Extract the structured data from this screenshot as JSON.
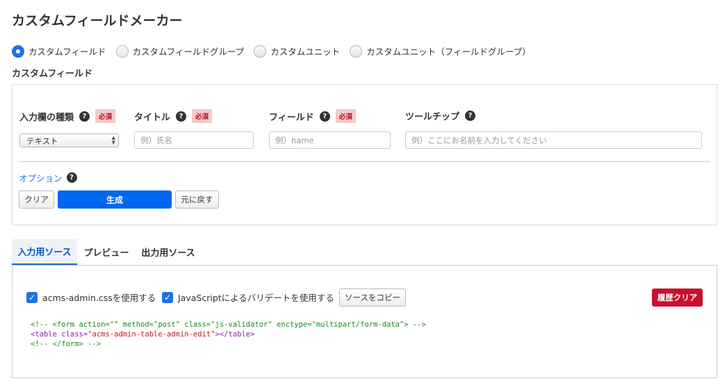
{
  "page_title": "カスタムフィールドメーカー",
  "radios": [
    {
      "label": "カスタムフィールド",
      "selected": true
    },
    {
      "label": "カスタムフィールドグループ",
      "selected": false
    },
    {
      "label": "カスタムユニット",
      "selected": false
    },
    {
      "label": "カスタムユニット（フィールドグループ）",
      "selected": false
    }
  ],
  "section_label": "カスタムフィールド",
  "columns": {
    "input_type": {
      "label": "入力欄の種類",
      "required": "必須",
      "value": "テキスト"
    },
    "title": {
      "label": "タイトル",
      "required": "必須",
      "placeholder": "例）氏名"
    },
    "field": {
      "label": "フィールド",
      "required": "必須",
      "placeholder": "例）name"
    },
    "tooltip": {
      "label": "ツールチップ",
      "placeholder": "例）ここにお名前を入力してください"
    }
  },
  "help_glyph": "?",
  "options_label": "オプション",
  "buttons": {
    "clear": "クリア",
    "generate": "生成",
    "undo": "元に戻す",
    "copy_source": "ソースをコピー",
    "clear_history": "履歴クリア"
  },
  "tabs": [
    {
      "label": "入力用ソース",
      "active": true
    },
    {
      "label": "プレビュー",
      "active": false
    },
    {
      "label": "出力用ソース",
      "active": false
    }
  ],
  "checkboxes": [
    {
      "label": "acms-admin.cssを使用する",
      "checked": true
    },
    {
      "label": "JavaScriptによるバリデートを使用する",
      "checked": true
    }
  ],
  "code": {
    "line1": "<!-- <form action=\"\" method=\"post\" class=\"js-validator\" enctype=\"multipart/form-data\"> -->",
    "line2_tag_open": "<table",
    "line2_attr": " class=",
    "line2_val": "\"acms-admin-table-admin-edit\"",
    "line2_tag_close": "></table>",
    "line3": "<!-- </form> -->"
  },
  "colors": {
    "accent": "#1a73e8",
    "primary_button": "#0066f0",
    "danger_button": "#c8102e",
    "required_badge_bg": "#f6c9c9",
    "required_badge_text": "#b7121e"
  }
}
